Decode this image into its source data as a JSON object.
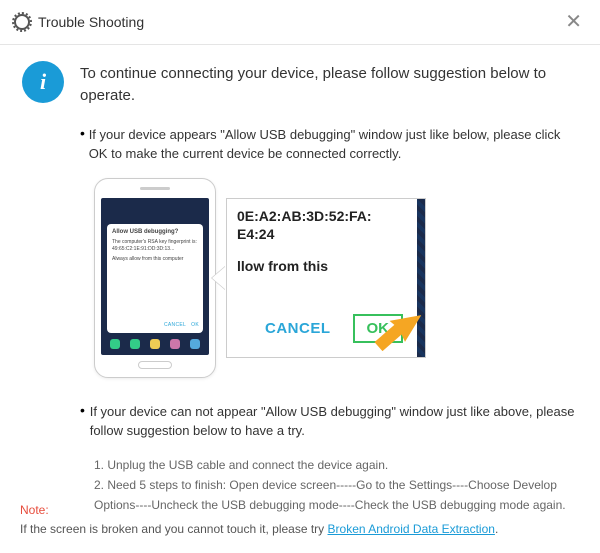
{
  "titlebar": {
    "title": "Trouble Shooting"
  },
  "heading": "To continue connecting your device, please follow suggestion below to operate.",
  "point1": "If your device appears \"Allow USB debugging\" window just like below, please click OK to make the current device  be connected correctly.",
  "zoom": {
    "mac_line1": "0E:A2:AB:3D:52:FA:",
    "mac_line2": "E4:24",
    "allow_text": "llow from this",
    "cancel": "CANCEL",
    "ok": "OK"
  },
  "phone": {
    "title": "Allow USB debugging?",
    "body1": "The computer's RSA key fingerprint is:",
    "body2": "49:65:C2:1E:91:DD:3D:13...",
    "body3": "Always allow from this computer",
    "cancel": "CANCEL",
    "ok": "OK"
  },
  "point2": "If your device can not appear \"Allow USB debugging\" window just like above, please follow suggestion below to have a try.",
  "steps": {
    "s1": "1. Unplug the USB cable and connect the device again.",
    "s2": "2. Need 5 steps to finish: Open device screen-----Go to the Settings----Choose Develop Options----Uncheck the USB debugging mode----Check the USB debugging mode again."
  },
  "footer": {
    "note": "Note:",
    "text": "If the screen is broken and you cannot touch it, please try ",
    "link": "Broken Android Data Extraction",
    "tail": "."
  }
}
